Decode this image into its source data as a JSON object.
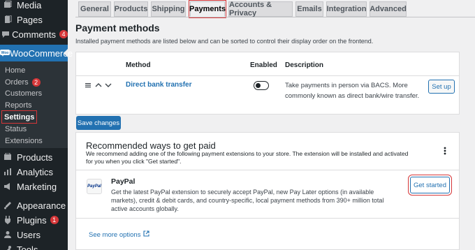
{
  "sidebar": {
    "top_items": [
      {
        "label": "Media",
        "icon": "media-icon"
      },
      {
        "label": "Pages",
        "icon": "pages-icon"
      },
      {
        "label": "Comments",
        "icon": "comments-icon",
        "badge": "4"
      }
    ],
    "woocommerce": {
      "label": "WooCommerce",
      "icon": "woocommerce-icon"
    },
    "submenu": [
      {
        "label": "Home"
      },
      {
        "label": "Orders",
        "badge": "2"
      },
      {
        "label": "Customers"
      },
      {
        "label": "Reports"
      },
      {
        "label": "Settings",
        "current": true
      },
      {
        "label": "Status"
      },
      {
        "label": "Extensions"
      }
    ],
    "bottom_items": [
      {
        "label": "Products",
        "icon": "products-icon"
      },
      {
        "label": "Analytics",
        "icon": "analytics-icon"
      },
      {
        "label": "Marketing",
        "icon": "marketing-icon"
      },
      {
        "label": "Appearance",
        "icon": "appearance-icon"
      },
      {
        "label": "Plugins",
        "icon": "plugins-icon",
        "badge": "1"
      },
      {
        "label": "Users",
        "icon": "users-icon"
      },
      {
        "label": "Tools",
        "icon": "tools-icon"
      }
    ]
  },
  "tabs": [
    {
      "label": "General"
    },
    {
      "label": "Products"
    },
    {
      "label": "Shipping"
    },
    {
      "label": "Payments",
      "active": true
    },
    {
      "label": "Accounts & Privacy"
    },
    {
      "label": "Emails"
    },
    {
      "label": "Integration"
    },
    {
      "label": "Advanced"
    }
  ],
  "payment_methods": {
    "title": "Payment methods",
    "intro": "Installed payment methods are listed below and can be sorted to control their display order on the frontend.",
    "columns": {
      "method": "Method",
      "enabled": "Enabled",
      "description": "Description"
    },
    "rows": [
      {
        "method": "Direct bank transfer",
        "enabled": false,
        "description": "Take payments in person via BACS. More commonly known as direct bank/wire transfer.",
        "action": "Set up"
      }
    ],
    "save_label": "Save changes"
  },
  "recommended": {
    "title": "Recommended ways to get paid",
    "intro": "We recommend adding one of the following payment extensions to your store. The extension will be installed and activated for you when you click \"Get started\".",
    "items": [
      {
        "name": "PayPal",
        "logo_text": "PayPal",
        "description": "Get the latest PayPal extension to securely accept PayPal, new Pay Later options (in available markets), credit & debit cards, and country-specific, local payment methods from 390+ million total active accounts globally.",
        "action": "Get started"
      }
    ],
    "see_more": "See more options"
  },
  "colors": {
    "accent": "#2271b1",
    "sidebar": "#1d2327",
    "highlight": "#d63638"
  }
}
